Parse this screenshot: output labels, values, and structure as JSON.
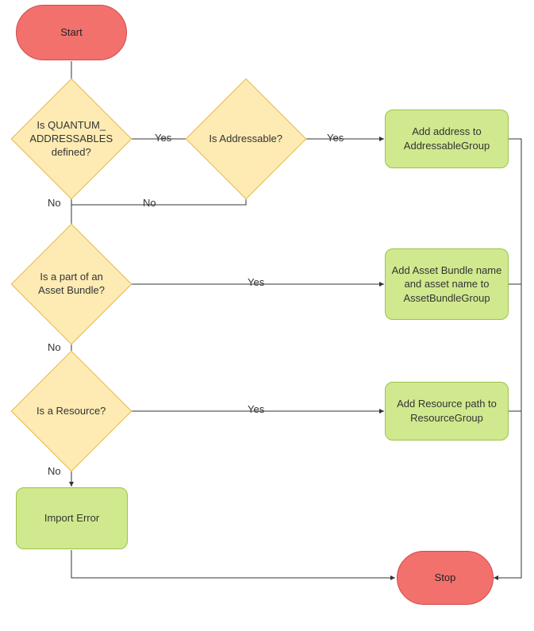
{
  "chart_data": {
    "type": "flowchart",
    "nodes": [
      {
        "id": "start",
        "type": "terminal",
        "label": "Start"
      },
      {
        "id": "d1",
        "type": "decision",
        "label": "Is QUANTUM_\nADDRESSABLES\ndefined?"
      },
      {
        "id": "d2",
        "type": "decision",
        "label": "Is\nAddressable?"
      },
      {
        "id": "p1",
        "type": "process",
        "label": "Add address to\nAddressableGroup"
      },
      {
        "id": "d3",
        "type": "decision",
        "label": "Is a part of an\nAsset Bundle?"
      },
      {
        "id": "p2",
        "type": "process",
        "label": "Add Asset Bundle\nname and asset\nname to\nAssetBundleGroup"
      },
      {
        "id": "d4",
        "type": "decision",
        "label": "Is a Resource?"
      },
      {
        "id": "p3",
        "type": "process",
        "label": "Add Resource path\nto ResourceGroup"
      },
      {
        "id": "p4",
        "type": "process",
        "label": "Import Error"
      },
      {
        "id": "stop",
        "type": "terminal",
        "label": "Stop"
      }
    ],
    "edges": [
      {
        "from": "start",
        "to": "d1",
        "label": ""
      },
      {
        "from": "d1",
        "to": "d2",
        "label": "Yes"
      },
      {
        "from": "d2",
        "to": "p1",
        "label": "Yes"
      },
      {
        "from": "d1",
        "to": "d3",
        "label": "No"
      },
      {
        "from": "d2",
        "to": "d3",
        "label": "No"
      },
      {
        "from": "d3",
        "to": "p2",
        "label": "Yes"
      },
      {
        "from": "d3",
        "to": "d4",
        "label": "No"
      },
      {
        "from": "d4",
        "to": "p3",
        "label": "Yes"
      },
      {
        "from": "d4",
        "to": "p4",
        "label": "No"
      },
      {
        "from": "p1",
        "to": "stop",
        "label": ""
      },
      {
        "from": "p2",
        "to": "stop",
        "label": ""
      },
      {
        "from": "p3",
        "to": "stop",
        "label": ""
      },
      {
        "from": "p4",
        "to": "stop",
        "label": ""
      }
    ]
  },
  "labels": {
    "start": "Start",
    "stop": "Stop",
    "d1": "Is QUANTUM_ ADDRESSABLES defined?",
    "d2": "Is Addressable?",
    "d3": "Is a part of an Asset Bundle?",
    "d4": "Is a Resource?",
    "p1": "Add address to AddressableGroup",
    "p2": "Add Asset Bundle name and asset name to AssetBundleGroup",
    "p3": "Add Resource path to ResourceGroup",
    "p4": "Import Error",
    "yes": "Yes",
    "no": "No"
  }
}
